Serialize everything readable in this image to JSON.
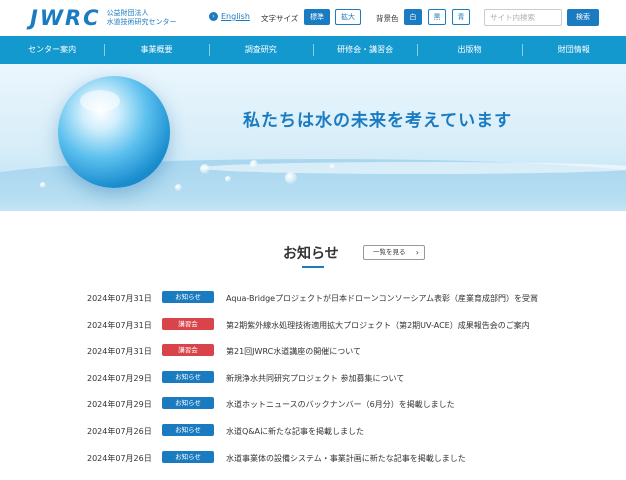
{
  "header": {
    "logo_mark": "JWRC",
    "logo_line1": "公益財団法人",
    "logo_line2": "水道技術研究センター",
    "lang_label": "English",
    "font_size_label": "文字サイズ",
    "font_standard": "標準",
    "font_large": "拡大",
    "bg_color_label": "背景色",
    "bg_white": "白",
    "bg_black": "黒",
    "bg_blue": "青",
    "search_placeholder": "サイト内検索",
    "search_button": "検索"
  },
  "nav": {
    "items": [
      {
        "label": "センター案内"
      },
      {
        "label": "事業概要"
      },
      {
        "label": "調査研究"
      },
      {
        "label": "研修会・講習会"
      },
      {
        "label": "出版物"
      },
      {
        "label": "財団情報"
      }
    ]
  },
  "hero": {
    "tagline": "私たちは水の未来を考えています"
  },
  "news": {
    "title": "お知らせ",
    "more_label": "一覧を見る",
    "more_icon": "chevron-right-icon",
    "items": [
      {
        "date": "2024年07月31日",
        "badge": "お知らせ",
        "badge_color": "#1a7bc1",
        "text": "Aqua-Bridgeプロジェクトが日本ドローンコンソーシアム表彰（産業育成部門）を受賞"
      },
      {
        "date": "2024年07月31日",
        "badge": "講習会",
        "badge_color": "#d9434a",
        "text": "第2期紫外線水処理技術適用拡大プロジェクト（第2期UV-ACE）成果報告会のご案内"
      },
      {
        "date": "2024年07月31日",
        "badge": "講習会",
        "badge_color": "#d9434a",
        "text": "第21回JWRC水道講座の開催について"
      },
      {
        "date": "2024年07月29日",
        "badge": "お知らせ",
        "badge_color": "#1a7bc1",
        "text": "新規浄水共同研究プロジェクト 参加募集について"
      },
      {
        "date": "2024年07月29日",
        "badge": "お知らせ",
        "badge_color": "#1a7bc1",
        "text": "水道ホットニュースのバックナンバー（6月分）を掲載しました"
      },
      {
        "date": "2024年07月26日",
        "badge": "お知らせ",
        "badge_color": "#1a7bc1",
        "text": "水道Q&Aに新たな記事を掲載しました"
      },
      {
        "date": "2024年07月26日",
        "badge": "お知らせ",
        "badge_color": "#1a7bc1",
        "text": "水道事業体の設備システム・事業計画に新たな記事を掲載しました"
      }
    ]
  }
}
